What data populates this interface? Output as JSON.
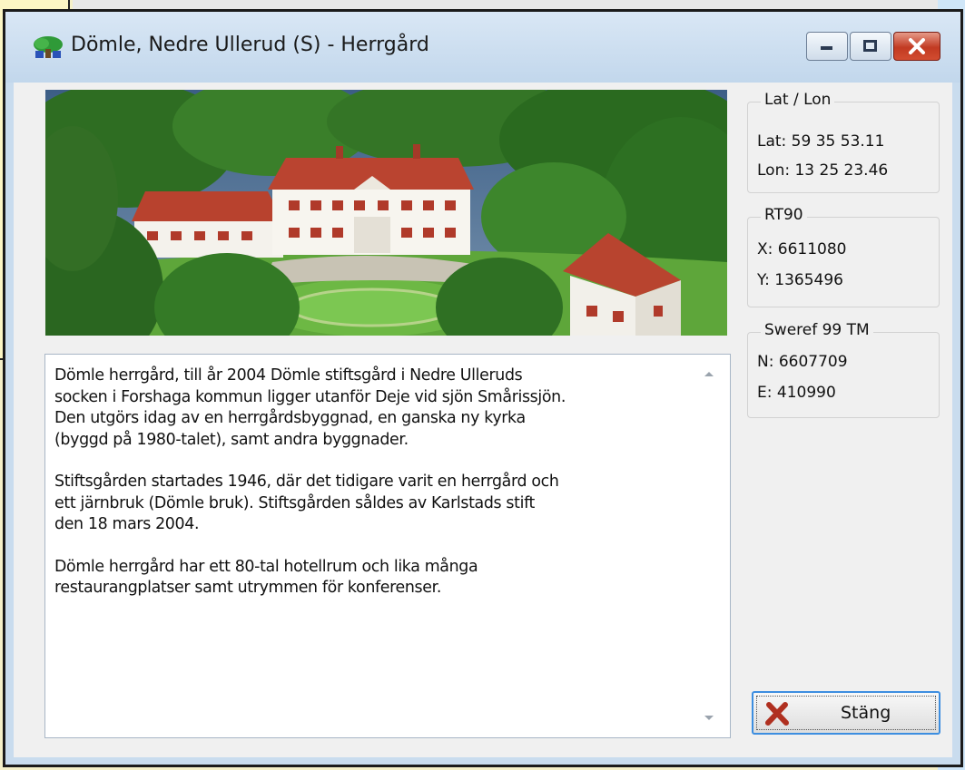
{
  "window": {
    "title": "Dömle, Nedre Ullerud (S) - Herrgård"
  },
  "description": {
    "paragraphs": [
      "Dömle herrgård, till år 2004 Dömle stiftsgård i Nedre Ulleruds\nsocken i Forshaga kommun ligger utanför Deje vid sjön Smårissjön.\nDen utgörs idag av en herrgårdsbyggnad, en ganska ny kyrka\n(byggd på 1980-talet), samt andra byggnader.",
      "Stiftsgården startades 1946, där det tidigare varit en herrgård och\nett järnbruk (Dömle bruk). Stiftsgården såldes av Karlstads stift\nden 18 mars 2004.",
      "Dömle herrgård har ett 80-tal hotellrum och lika många\nrestaurangplatser samt utrymmen för konferenser."
    ]
  },
  "coordinates": {
    "latlon": {
      "legend": "Lat / Lon",
      "lat": "Lat: 59 35 53.11",
      "lon": "Lon: 13 25 23.46"
    },
    "rt90": {
      "legend": "RT90",
      "x": "X: 6611080",
      "y": "Y: 1365496"
    },
    "sweref": {
      "legend": "Sweref 99 TM",
      "n": "N: 6607709",
      "e": "E: 410990"
    }
  },
  "buttons": {
    "close_label": "Stäng"
  },
  "colors": {
    "close_x": "#b03020",
    "window_frame": "#c9dcee",
    "client_bg": "#f0f0f0"
  },
  "icons": {
    "app": "tree-icon",
    "minimize": "minimize-icon",
    "maximize": "maximize-icon",
    "close": "close-icon",
    "button_close": "red-x-icon"
  }
}
